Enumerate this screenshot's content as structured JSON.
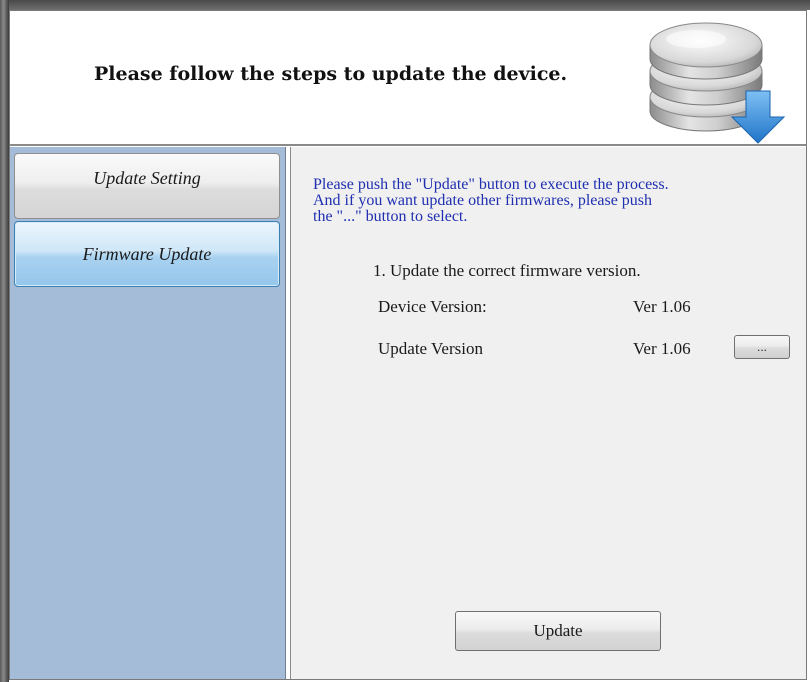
{
  "header": {
    "title": "Please follow the steps to update the device.",
    "icon": "database-download-icon"
  },
  "sidebar": {
    "items": [
      {
        "label": "Update Setting",
        "selected": false
      },
      {
        "label": "Firmware Update",
        "selected": true
      }
    ]
  },
  "content": {
    "instructions": [
      "Please push the \"Update\" button to execute the process.",
      "And if you want update other firmwares, please push",
      "the \"...\" button to select."
    ],
    "step": "1. Update the correct firmware version.",
    "device_version": {
      "label": "Device Version:",
      "value": "Ver 1.06"
    },
    "update_version": {
      "label": "Update Version",
      "value": "Ver 1.06"
    },
    "browse_label": "...",
    "update_label": "Update"
  },
  "colors": {
    "instruction_text": "#1f2fb0",
    "sidebar_bg": "#a4bcd8",
    "selected_item": "#a9d2f0",
    "download_arrow": "#2f8ee0"
  }
}
